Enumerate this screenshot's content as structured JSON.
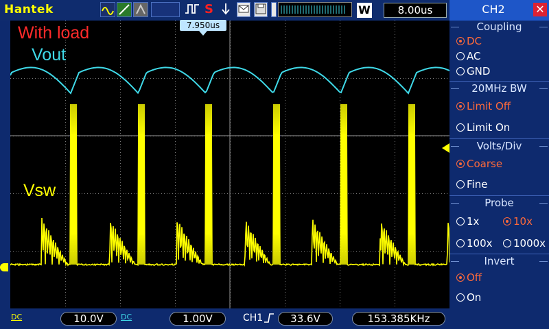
{
  "brand": "Hantek",
  "run_state": "S",
  "timebase": "8.00us",
  "trigger_position": "7.950us",
  "annotations": {
    "title": "With load",
    "ch1": "Vout",
    "ch2": "Vsw"
  },
  "panel": {
    "title": "CH2",
    "close_icon": "close-icon",
    "coupling": {
      "label": "Coupling",
      "options": [
        "DC",
        "AC",
        "GND"
      ],
      "selected": "DC"
    },
    "bandwidth": {
      "label": "20MHz BW",
      "options": [
        "Limit Off",
        "Limit On"
      ],
      "selected": "Limit Off"
    },
    "volts_div": {
      "label": "Volts/Div",
      "options": [
        "Coarse",
        "Fine"
      ],
      "selected": "Coarse"
    },
    "probe": {
      "label": "Probe",
      "options": [
        "1x",
        "10x",
        "100x",
        "1000x"
      ],
      "selected": "10x"
    },
    "invert": {
      "label": "Invert",
      "options": [
        "Off",
        "On"
      ],
      "selected": "Off"
    }
  },
  "bottom": {
    "ch1_coupling": "DC",
    "ch1_scale": "10.0V",
    "ch2_coupling": "DC",
    "ch2_scale": "1.00V",
    "trigger_source": "CH1",
    "trigger_level": "33.6V",
    "frequency": "153.385KHz"
  },
  "colors": {
    "ch_yellow": "#ffff00",
    "ch_cyan": "#3fd9e8",
    "selected_option": "#ff6a3a",
    "annotation_red": "#ff2a2a"
  }
}
